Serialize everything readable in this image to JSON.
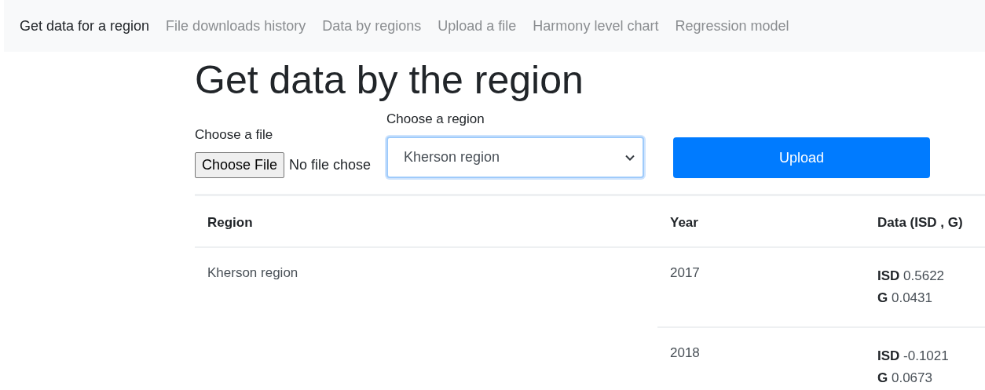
{
  "nav": [
    {
      "label": "Get data for a region",
      "selected": true
    },
    {
      "label": "File downloads history",
      "selected": false
    },
    {
      "label": "Data by regions",
      "selected": false
    },
    {
      "label": "Upload a file",
      "selected": false
    },
    {
      "label": "Harmony level chart",
      "selected": false
    },
    {
      "label": "Regression model",
      "selected": false
    }
  ],
  "heading": "Get data by the region",
  "file": {
    "label": "Choose a file",
    "button": "Choose File",
    "status": "No file chose"
  },
  "region": {
    "label": "Choose a region",
    "value": "Kherson region"
  },
  "upload_button": "Upload",
  "table": {
    "columns": [
      "Region",
      "Year",
      "Data (**ISD** , **G**)"
    ],
    "rows": [
      {
        "region": "Kherson region",
        "years": [
          {
            "year": "2017",
            "data": [
              "**ISD** 0.5622",
              "**G** 0.0431"
            ]
          },
          {
            "year": "2018",
            "data": [
              "**ISD** -0.1021",
              "**G** 0.0673"
            ]
          }
        ]
      }
    ]
  }
}
